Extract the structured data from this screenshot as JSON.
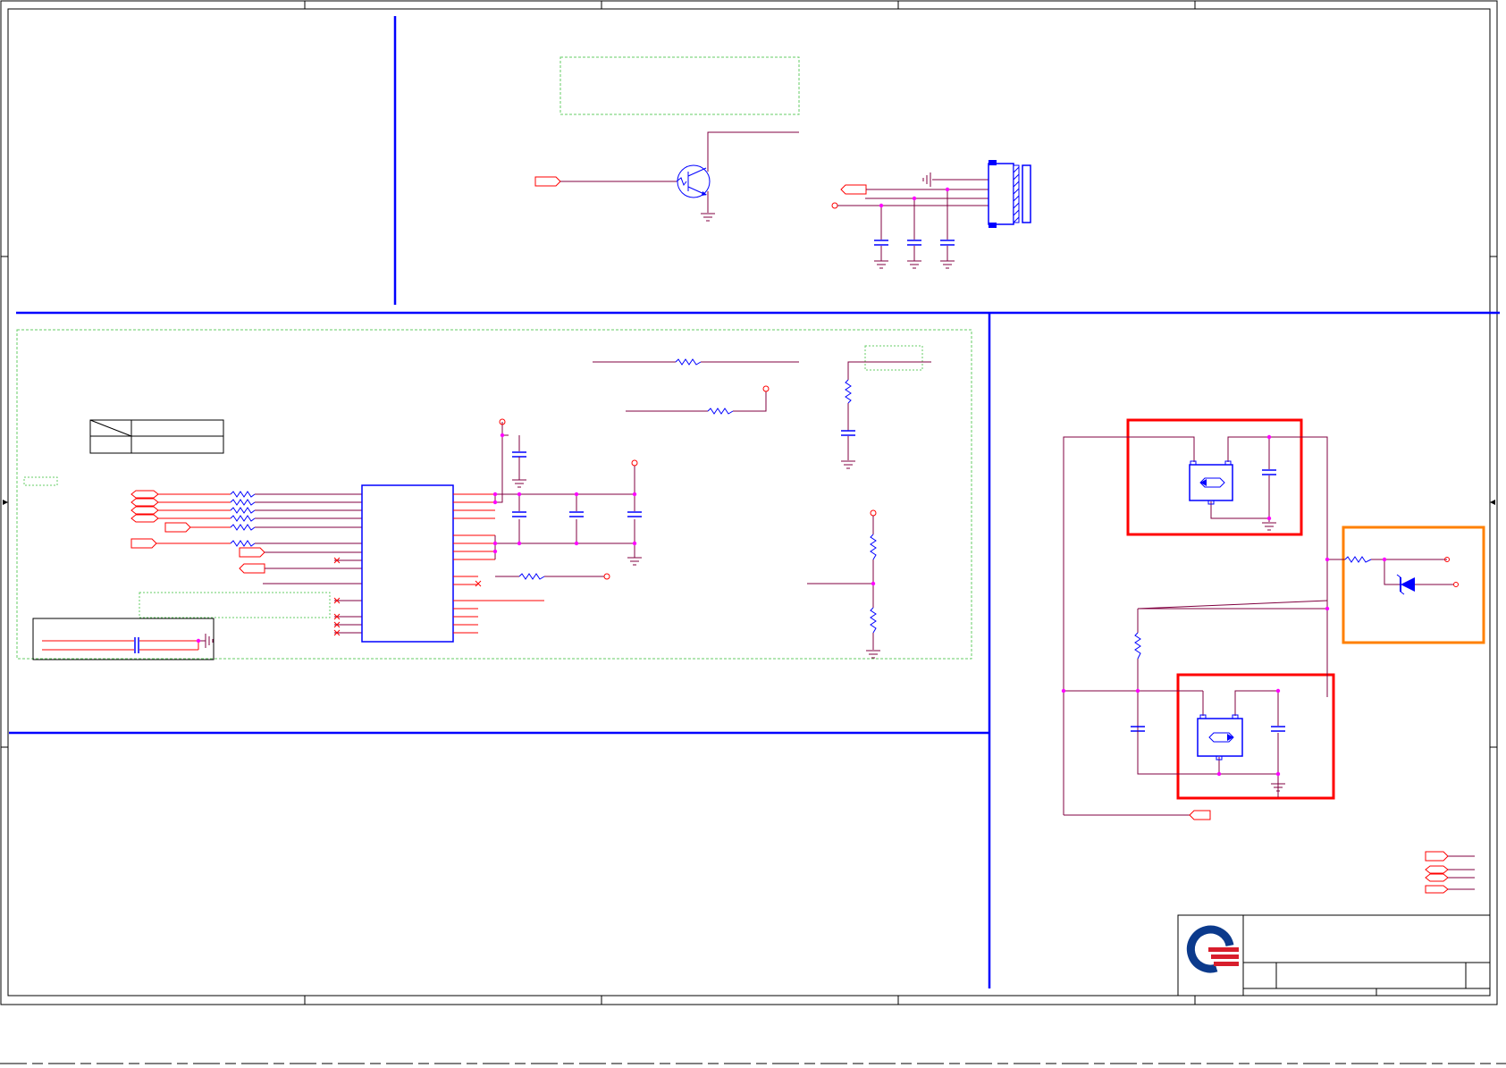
{
  "document": {
    "kind": "electronic schematic sheet",
    "visible_text": []
  },
  "colors": {
    "border": "#000000",
    "bus_line": "#0000ff",
    "net_wire": "#800040",
    "signal_wire": "#ff0000",
    "component": "#0000ff",
    "junction": "#ff00ff",
    "note_box": "#66cc66",
    "highlight_red": "#ff0000",
    "highlight_orange": "#ff8000",
    "logo_blue": "#0b3a8c",
    "logo_red": "#d81e2c"
  },
  "icons": {
    "logo": "company-logo-icon",
    "transistor": "npn-transistor-icon",
    "ground": "ground-icon",
    "resistor": "resistor-icon",
    "capacitor": "capacitor-icon",
    "connector": "connector-icon",
    "diode": "diode-icon",
    "regulator": "regulator-icon",
    "offpage": "offpage-connector-icon"
  }
}
